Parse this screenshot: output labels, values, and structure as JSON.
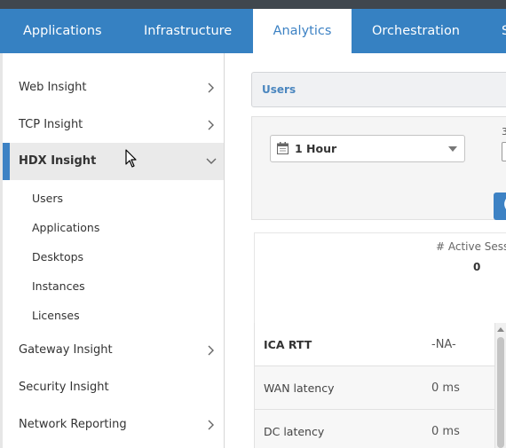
{
  "top_nav": {
    "tabs": [
      {
        "label": "Applications",
        "active": false
      },
      {
        "label": "Infrastructure",
        "active": false
      },
      {
        "label": "Analytics",
        "active": true
      },
      {
        "label": "Orchestration",
        "active": false
      },
      {
        "label": "S",
        "active": false
      }
    ]
  },
  "sidebar": {
    "items": [
      {
        "label": "Web Insight",
        "icon": "chevron-right-icon"
      },
      {
        "label": "TCP Insight",
        "icon": "chevron-right-icon"
      },
      {
        "label": "HDX Insight",
        "icon": "chevron-down-icon",
        "active": true
      },
      {
        "label": "Gateway Insight",
        "icon": "chevron-right-icon"
      },
      {
        "label": "Security Insight"
      },
      {
        "label": "Network Reporting",
        "icon": "chevron-right-icon"
      }
    ],
    "hdx_subitems": [
      "Users",
      "Applications",
      "Desktops",
      "Instances",
      "Licenses"
    ]
  },
  "main": {
    "header_title": "Users",
    "time_filter": {
      "selected": "1 Hour",
      "icon": "calendar-icon"
    },
    "cut_label": "3",
    "stats": {
      "label": "# Active Sessio",
      "value": "0"
    },
    "table": {
      "header": {
        "name": "ICA RTT",
        "value": "-NA-"
      },
      "rows": [
        {
          "name": "WAN latency",
          "value": "0 ms"
        },
        {
          "name": "DC latency",
          "value": "0 ms"
        }
      ]
    }
  },
  "colors": {
    "nav_bg": "#3681c2",
    "accent": "#3d82c4",
    "top_strip": "#40474e"
  }
}
